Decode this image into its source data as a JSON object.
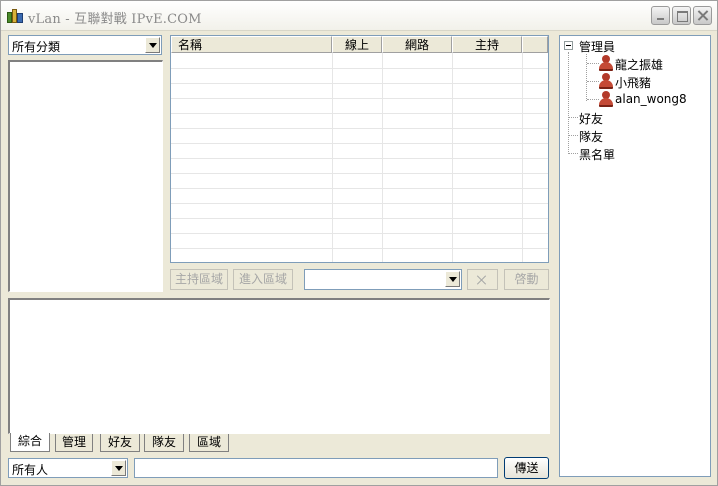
{
  "window": {
    "title": "vLan - 互聯對戰 IPvE.COM"
  },
  "left": {
    "category_select": {
      "value": "所有分類"
    }
  },
  "list": {
    "columns": [
      "名稱",
      "線上",
      "網路",
      "主持"
    ]
  },
  "toolbar": {
    "host_area": "主持區域",
    "enter_area": "進入區域",
    "area_select_value": "",
    "close_glyph": "✕",
    "start": "啓動"
  },
  "tabs": [
    "綜合",
    "管理",
    "好友",
    "隊友",
    "區域"
  ],
  "bottom": {
    "recipient_select": {
      "value": "所有人"
    },
    "message_input": {
      "value": ""
    },
    "send": "傳送"
  },
  "tree": {
    "admins": {
      "label": "管理員",
      "users": [
        "龍之振雄",
        "小飛豬",
        "alan_wong8"
      ]
    },
    "groups": [
      "好友",
      "隊友",
      "黑名單"
    ]
  }
}
